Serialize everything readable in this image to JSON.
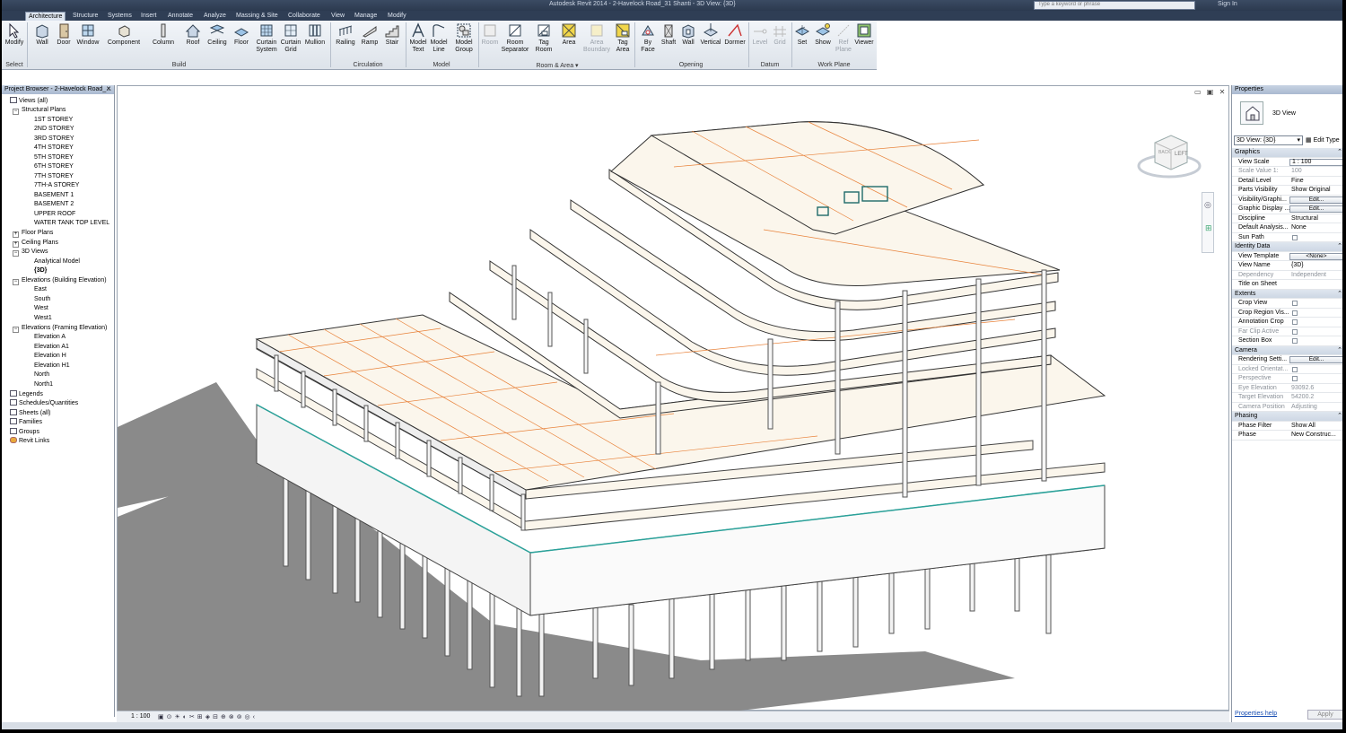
{
  "titlebar": {
    "title": "Autodesk Revit 2014 - 2-Havelock Road_31 Shanti - 3D View: {3D}",
    "search_placeholder": "Type a keyword or phrase",
    "signin": "Sign In"
  },
  "tabs": [
    "Architecture",
    "Structure",
    "Systems",
    "Insert",
    "Annotate",
    "Analyze",
    "Massing & Site",
    "Collaborate",
    "View",
    "Manage",
    "Modify"
  ],
  "ribbon": {
    "modify": "Modify",
    "select": "Select",
    "build": [
      "Wall",
      "Door",
      "Window",
      "Component",
      "Column",
      "Roof",
      "Ceiling",
      "Floor",
      "Curtain System",
      "Curtain Grid",
      "Mullion"
    ],
    "circulation": [
      "Railing",
      "Ramp",
      "Stair"
    ],
    "model": [
      "Model Text",
      "Model Line",
      "Model Group"
    ],
    "room_area": [
      "Room",
      "Room Separator",
      "Tag Room",
      "Area",
      "Area Boundary",
      "Tag Area"
    ],
    "opening": [
      "By Face",
      "Shaft",
      "Wall",
      "Vertical",
      "Dormer"
    ],
    "datum": [
      "Level",
      "Grid"
    ],
    "work_plane": [
      "Set",
      "Show",
      "Ref Plane",
      "Viewer"
    ],
    "panels": {
      "build": "Build",
      "circulation": "Circulation",
      "model": "Model",
      "room_area": "Room & Area ▾",
      "opening": "Opening",
      "datum": "Datum",
      "work_plane": "Work Plane"
    }
  },
  "browser": {
    "title": "Project Browser - 2-Havelock Road_...",
    "views_all": "Views (all)",
    "structural_plans": "Structural Plans",
    "structural_items": [
      "1ST STOREY",
      "2ND STOREY",
      "3RD STOREY",
      "4TH STOREY",
      "5TH STOREY",
      "6TH STOREY",
      "7TH STOREY",
      "7TH-A STOREY",
      "BASEMENT 1",
      "BASEMENT 2",
      "UPPER ROOF",
      "WATER TANK TOP LEVEL"
    ],
    "floor_plans": "Floor Plans",
    "ceiling_plans": "Ceiling Plans",
    "views_3d": "3D Views",
    "views_3d_items": [
      "Analytical Model",
      "{3D}"
    ],
    "elev_building": "Elevations (Building Elevation)",
    "elev_building_items": [
      "East",
      "South",
      "West",
      "West1"
    ],
    "elev_framing": "Elevations (Framing Elevation)",
    "elev_framing_items": [
      "Elevation A",
      "Elevation A1",
      "Elevation H",
      "Elevation H1",
      "North",
      "North1"
    ],
    "roots": [
      "Legends",
      "Schedules/Quantities",
      "Sheets (all)",
      "Families",
      "Groups",
      "Revit Links"
    ]
  },
  "viewcube": {
    "face": "LEFT",
    "front": "BACK"
  },
  "view_control": {
    "scale": "1 : 100"
  },
  "properties": {
    "title": "Properties",
    "type_name": "3D View",
    "selector": "3D View: {3D}",
    "edit_type": "Edit Type",
    "sections": {
      "graphics": "Graphics",
      "identity": "Identity Data",
      "extents": "Extents",
      "camera": "Camera",
      "phasing": "Phasing"
    },
    "graphics": [
      [
        "View Scale",
        "1 : 100"
      ],
      [
        "Scale Value  1:",
        "100"
      ],
      [
        "Detail Level",
        "Fine"
      ],
      [
        "Parts Visibility",
        "Show Original"
      ],
      [
        "Visibility/Graphi...",
        "Edit..."
      ],
      [
        "Graphic Display ...",
        "Edit..."
      ],
      [
        "Discipline",
        "Structural"
      ],
      [
        "Default Analysis...",
        "None"
      ],
      [
        "Sun Path",
        ""
      ]
    ],
    "identity": [
      [
        "View Template",
        "<None>"
      ],
      [
        "View Name",
        "{3D}"
      ],
      [
        "Dependency",
        "Independent"
      ],
      [
        "Title on Sheet",
        ""
      ]
    ],
    "extents": [
      [
        "Crop View",
        ""
      ],
      [
        "Crop Region Vis...",
        ""
      ],
      [
        "Annotation Crop",
        ""
      ],
      [
        "Far Clip Active",
        ""
      ],
      [
        "Section Box",
        ""
      ]
    ],
    "camera": [
      [
        "Rendering Setti...",
        "Edit..."
      ],
      [
        "Locked Orientat...",
        ""
      ],
      [
        "Perspective",
        ""
      ],
      [
        "Eye Elevation",
        "93092.6"
      ],
      [
        "Target Elevation",
        "54200.2"
      ],
      [
        "Camera Position",
        "Adjusting"
      ]
    ],
    "phasing": [
      [
        "Phase Filter",
        "Show All"
      ],
      [
        "Phase",
        "New Construc..."
      ]
    ],
    "help": "Properties help",
    "apply": "Apply"
  },
  "colors": {
    "accent": "#2f3e55",
    "grid_line": "#e8823a",
    "slab": "#fbf6ec",
    "shadow": "#8a8a8a"
  }
}
